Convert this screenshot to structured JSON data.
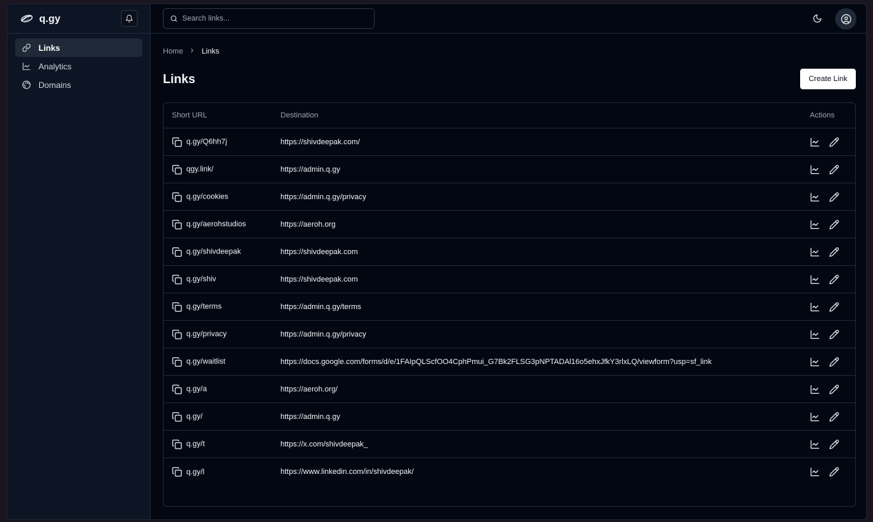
{
  "app": {
    "brand": "q.gy"
  },
  "sidebar": {
    "items": [
      {
        "label": "Links",
        "icon": "link-icon",
        "active": true
      },
      {
        "label": "Analytics",
        "icon": "chart-icon",
        "active": false
      },
      {
        "label": "Domains",
        "icon": "globe-icon",
        "active": false
      }
    ]
  },
  "topbar": {
    "search_placeholder": "Search links..."
  },
  "breadcrumb": {
    "home": "Home",
    "current": "Links"
  },
  "page": {
    "title": "Links",
    "create_label": "Create Link"
  },
  "table": {
    "headers": {
      "short": "Short URL",
      "destination": "Destination",
      "actions": "Actions"
    },
    "rows": [
      {
        "short": "q.gy/Q6hh7j",
        "destination": "https://shivdeepak.com/"
      },
      {
        "short": "qgy.link/",
        "destination": "https://admin.q.gy"
      },
      {
        "short": "q.gy/cookies",
        "destination": "https://admin.q.gy/privacy"
      },
      {
        "short": "q.gy/aerohstudios",
        "destination": "https://aeroh.org"
      },
      {
        "short": "q.gy/shivdeepak",
        "destination": "https://shivdeepak.com"
      },
      {
        "short": "q.gy/shiv",
        "destination": "https://shivdeepak.com"
      },
      {
        "short": "q.gy/terms",
        "destination": "https://admin.q.gy/terms"
      },
      {
        "short": "q.gy/privacy",
        "destination": "https://admin.q.gy/privacy"
      },
      {
        "short": "q.gy/waitlist",
        "destination": "https://docs.google.com/forms/d/e/1FAIpQLScfOO4CphPmui_G7Bk2FLSG3pNPTADAl16o5ehxJfkY3rlxLQ/viewform?usp=sf_link"
      },
      {
        "short": "q.gy/a",
        "destination": "https://aeroh.org/"
      },
      {
        "short": "q.gy/",
        "destination": "https://admin.q.gy"
      },
      {
        "short": "q.gy/t",
        "destination": "https://x.com/shivdeepak_"
      },
      {
        "short": "q.gy/l",
        "destination": "https://www.linkedin.com/in/shivdeepak/"
      }
    ]
  }
}
